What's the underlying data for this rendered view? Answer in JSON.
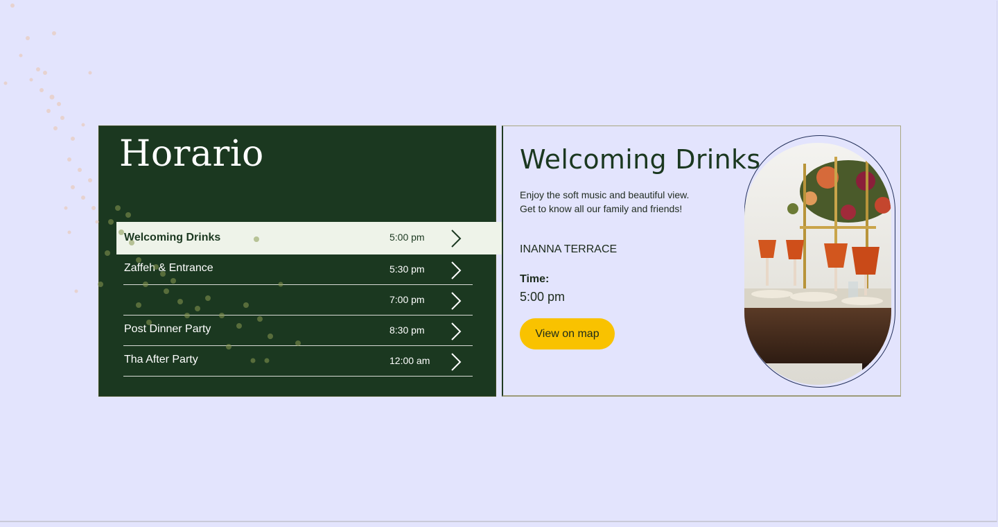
{
  "schedule": {
    "title": "Horario",
    "events": [
      {
        "name": "Welcoming Drinks",
        "time": "5:00 pm"
      },
      {
        "name": "Zaffeh & Entrance",
        "time": "5:30 pm"
      },
      {
        "name": "",
        "time": "7:00 pm"
      },
      {
        "name": "Post Dinner Party",
        "time": "8:30 pm"
      },
      {
        "name": "Tha After Party",
        "time": "12:00 am"
      }
    ],
    "active_index": 0
  },
  "detail": {
    "title": "Welcoming Drinks",
    "description_line1": "Enjoy the soft music and beautiful view.",
    "description_line2": "Get to know all our family and friends!",
    "venue": "INANNA TERRACE",
    "time_label": "Time:",
    "time_value": "5:00 pm",
    "map_button_label": "View on map",
    "photo_icon": "banquet-table-photo"
  },
  "colors": {
    "background": "#e3e4fd",
    "card_green": "#1b3820",
    "active_row": "#eef3e9",
    "button_yellow": "#f9c200",
    "text_dark": "#1b2a1b"
  }
}
